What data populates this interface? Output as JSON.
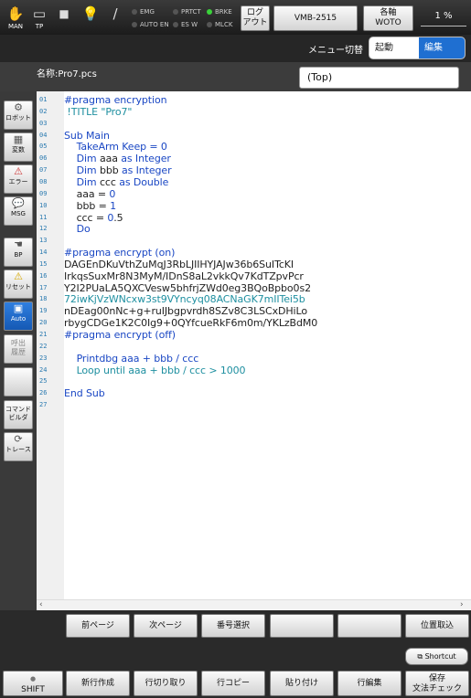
{
  "top_bar": {
    "man_label": "MAN",
    "tp_label": "TP",
    "status_leds": [
      {
        "label": "EMG",
        "on": false
      },
      {
        "label": "AUTO EN",
        "on": false
      },
      {
        "label": "PRTCT",
        "on": false
      },
      {
        "label": "ES W",
        "on": false
      },
      {
        "label": "BRKE",
        "on": true
      },
      {
        "label": "MLCK",
        "on": false
      }
    ],
    "logout_line1": "ログ",
    "logout_line2": "アウト",
    "model": "VMB-2515",
    "axis_line1": "各軸",
    "axis_line2": "WOTO",
    "speed": "1 %"
  },
  "menu": {
    "switch_label": "メニュー切替",
    "segment_start": "起動",
    "segment_edit": "編集"
  },
  "name_row": {
    "program_name": "名称:Pro7.pcs",
    "procedure": "(Top)"
  },
  "side_buttons": [
    {
      "label": "ロボット",
      "icon": "robot-icon"
    },
    {
      "label": "変数",
      "icon": "variable-icon"
    },
    {
      "label": "エラー",
      "icon": "error-icon"
    },
    {
      "label": "MSG",
      "icon": "message-icon"
    },
    {
      "label": "BP",
      "icon": "hand-icon"
    },
    {
      "label": "リセット",
      "icon": "warning-icon"
    },
    {
      "label": "Auto",
      "icon": "auto-icon"
    },
    {
      "label": "呼出\n履歴",
      "icon": "call-history-icon"
    },
    {
      "label": "",
      "icon": "blank-icon"
    },
    {
      "label": "コマンド\nビルダ",
      "icon": "command-builder-icon"
    },
    {
      "label": "トレース",
      "icon": "trace-icon"
    }
  ],
  "code_lines": [
    {
      "n": "01",
      "segs": [
        {
          "t": "#pragma encryption",
          "c": "k"
        }
      ]
    },
    {
      "n": "02",
      "segs": [
        {
          "t": " !TITLE \"Pro7\"",
          "c": "t"
        }
      ]
    },
    {
      "n": "03",
      "segs": []
    },
    {
      "n": "04",
      "segs": [
        {
          "t": "Sub Main",
          "c": "k"
        }
      ]
    },
    {
      "n": "05",
      "segs": [
        {
          "t": "    TakeArm Keep = 0",
          "c": "k"
        }
      ]
    },
    {
      "n": "06",
      "segs": [
        {
          "t": "    Dim ",
          "c": "k"
        },
        {
          "t": "aaa ",
          "c": "d"
        },
        {
          "t": "as Integer",
          "c": "k"
        }
      ]
    },
    {
      "n": "07",
      "segs": [
        {
          "t": "    Dim ",
          "c": "k"
        },
        {
          "t": "bbb ",
          "c": "d"
        },
        {
          "t": "as Integer",
          "c": "k"
        }
      ]
    },
    {
      "n": "08",
      "segs": [
        {
          "t": "    Dim ",
          "c": "k"
        },
        {
          "t": "ccc ",
          "c": "d"
        },
        {
          "t": "as Double",
          "c": "k"
        }
      ]
    },
    {
      "n": "09",
      "segs": [
        {
          "t": "    aaa = ",
          "c": "d"
        },
        {
          "t": "0",
          "c": "k"
        }
      ]
    },
    {
      "n": "10",
      "segs": [
        {
          "t": "    bbb = ",
          "c": "d"
        },
        {
          "t": "1",
          "c": "k"
        }
      ]
    },
    {
      "n": "11",
      "segs": [
        {
          "t": "    ccc = ",
          "c": "d"
        },
        {
          "t": "0",
          "c": "k"
        },
        {
          "t": ".5",
          "c": "d"
        }
      ]
    },
    {
      "n": "12",
      "segs": [
        {
          "t": "    Do",
          "c": "k"
        }
      ]
    },
    {
      "n": "13",
      "segs": []
    },
    {
      "n": "14",
      "segs": [
        {
          "t": "#pragma encrypt (on)",
          "c": "k"
        }
      ]
    },
    {
      "n": "15",
      "segs": [
        {
          "t": "DAGEnDKuVthZuMqJ3RbLJIIHYJAJw36b6SuITcKI",
          "c": "d"
        }
      ]
    },
    {
      "n": "16",
      "segs": [
        {
          "t": "IrkqsSuxMr8N3MyM/IDnS8aL2vkkQv7KdTZpvPcr",
          "c": "d"
        }
      ]
    },
    {
      "n": "17",
      "segs": [
        {
          "t": "Y2I2PUaLA5QXCVesw5bhfrjZWd0eg3BQoBpbo0s2",
          "c": "d"
        }
      ]
    },
    {
      "n": "18",
      "segs": [
        {
          "t": "72iwKjVzWNcxw3st9VYncyq08ACNaGK7mIITei5b",
          "c": "t"
        }
      ]
    },
    {
      "n": "19",
      "segs": [
        {
          "t": "nDEag00nNc+g+ruIJbgpvrdh8SZv8C3LSCxDHiLo",
          "c": "d"
        }
      ]
    },
    {
      "n": "20",
      "segs": [
        {
          "t": "rbygCDGe1K2C0Ig9+0QYfcueRkF6m0m/YKLzBdM0",
          "c": "d"
        }
      ]
    },
    {
      "n": "21",
      "segs": [
        {
          "t": "#pragma encrypt (off)",
          "c": "k"
        }
      ]
    },
    {
      "n": "22",
      "segs": []
    },
    {
      "n": "23",
      "segs": [
        {
          "t": "    Printdbg aaa + bbb / ccc",
          "c": "k"
        }
      ]
    },
    {
      "n": "24",
      "segs": [
        {
          "t": "    Loop until aaa + bbb / ccc > 1000",
          "c": "t"
        }
      ]
    },
    {
      "n": "25",
      "segs": []
    },
    {
      "n": "26",
      "segs": [
        {
          "t": "End Sub",
          "c": "k"
        }
      ]
    },
    {
      "n": "27",
      "segs": []
    }
  ],
  "function_row1": [
    "前ページ",
    "次ページ",
    "番号選択",
    "",
    "",
    "位置取込"
  ],
  "function_row2": [
    "SHIFT",
    "新行作成",
    "行切り取り",
    "行コピー",
    "貼り付け",
    "行編集",
    "保存\n文法チェック"
  ],
  "shortcut_label": "Shortcut",
  "colors": {
    "accent": "#1f6fd1",
    "keyword": "#1a47c4",
    "comment": "#1e8fa0",
    "line_number": "#2a7ab0"
  }
}
